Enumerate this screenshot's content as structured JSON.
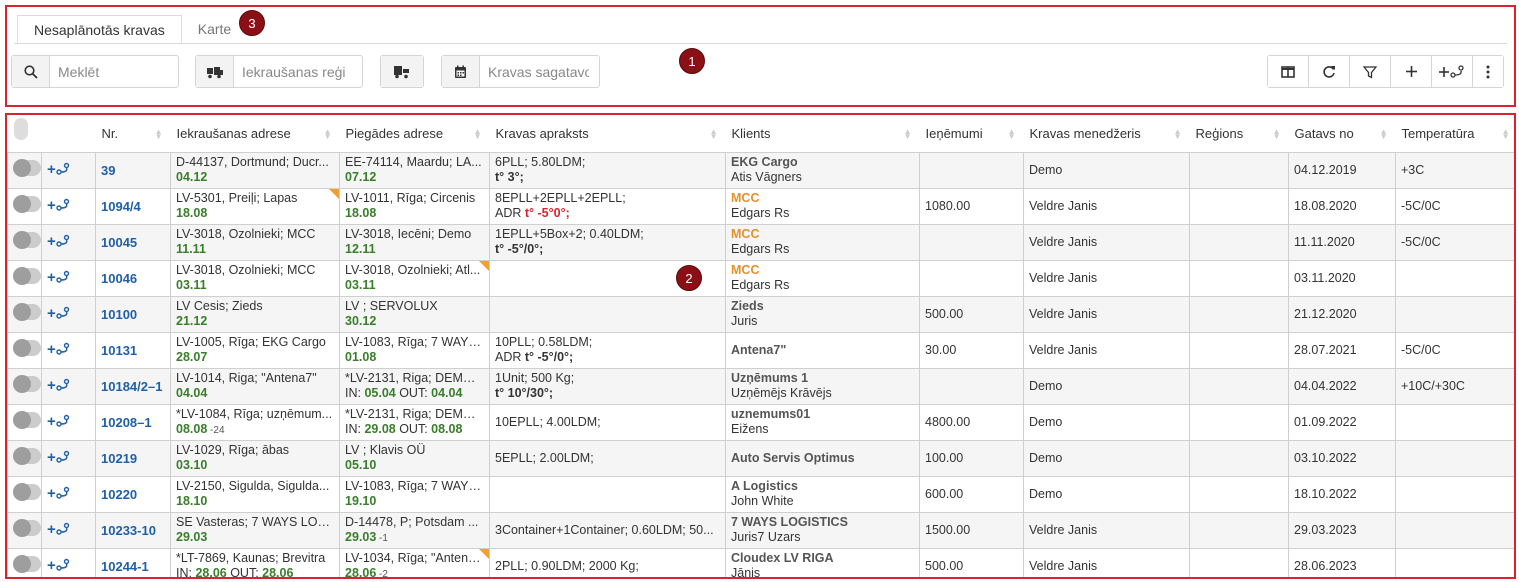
{
  "tabs": [
    {
      "label": "Nesaplānotās kravas",
      "active": true
    },
    {
      "label": "Karte",
      "active": false
    }
  ],
  "badges": [
    "1",
    "2",
    "3"
  ],
  "filters": {
    "search_placeholder": "Meklēt",
    "loading_region_placeholder": "Iekraušanas reģi",
    "cargo_ready_placeholder": "Kravas sagatavo"
  },
  "icons": {
    "search": "search-icon",
    "truck_loading": "truck-loading-icon",
    "truck_unloading": "truck-unloading-icon",
    "calendar": "calendar-icon",
    "columns": "columns-icon",
    "refresh": "refresh-icon",
    "filter": "filter-icon",
    "add": "plus-icon",
    "add_route": "add-route-icon",
    "more": "more-vertical-icon"
  },
  "colors": {
    "frame": "#d9232e",
    "badge": "#8b1015",
    "link": "#1f5fa6",
    "date": "#3a7d2c",
    "mcc": "#e0922b"
  },
  "table": {
    "headers": [
      "Nr.",
      "Iekraušanas adrese",
      "Piegādes adrese",
      "Kravas apraksts",
      "Klients",
      "Ieņēmumi",
      "Kravas menedžeris",
      "Reģions",
      "Gatavs no",
      "Temperatūra"
    ],
    "rows": [
      {
        "nr": "39",
        "load": "D-44137, Dortmund; Ducr...",
        "load_date": "04.12",
        "deliv": "EE-74114, Maardu; LA...",
        "deliv_date": "07.12",
        "desc1": "6PLL; 5.80LDM;",
        "desc2_pre": "",
        "desc2": "t° 3°;",
        "client": "EKG Cargo",
        "contact": "Atis Vāgners",
        "income": "",
        "manager": "Demo",
        "region": "",
        "ready": "04.12.2019",
        "temp": "+3C"
      },
      {
        "nr": "1094/4",
        "load": "LV-5301, Preiļi; Lapas",
        "load_date": "18.08",
        "load_flag": true,
        "deliv": "LV-1011, Rīga; Circenis",
        "deliv_date": "18.08",
        "desc1": "8EPLL+2EPLL+2EPLL;",
        "desc2_pre": "ADR ",
        "desc2": "t° -5°0°;",
        "desc2_red": true,
        "client": "MCC",
        "client_orange": true,
        "contact": "Edgars Rs",
        "income": "1080.00",
        "manager": "Veldre Janis",
        "region": "",
        "ready": "18.08.2020",
        "temp": "-5C/0C"
      },
      {
        "nr": "10045",
        "load": "LV-3018, Ozolnieki; MCC",
        "load_date": "11.11",
        "deliv": "LV-3018, Iecēni; Demo",
        "deliv_date": "12.11",
        "desc1": "1EPLL+5Box+2; 0.40LDM;",
        "desc2_pre": "",
        "desc2": "t° -5°/0°;",
        "client": "MCC",
        "client_orange": true,
        "contact": "Edgars Rs",
        "income": "",
        "manager": "Veldre Janis",
        "region": "",
        "ready": "11.11.2020",
        "temp": "-5C/0C"
      },
      {
        "nr": "10046",
        "load": "LV-3018, Ozolnieki; MCC",
        "load_date": "03.11",
        "deliv": "LV-3018, Ozolnieki; Atl...",
        "deliv_date": "03.11",
        "deliv_flag": true,
        "desc1": "",
        "desc2_pre": "",
        "desc2": "",
        "client": "MCC",
        "client_orange": true,
        "contact": "Edgars Rs",
        "income": "",
        "manager": "Veldre Janis",
        "region": "",
        "ready": "03.11.2020",
        "temp": ""
      },
      {
        "nr": "10100",
        "load": "LV Cesis; Zieds",
        "load_date": "21.12",
        "deliv": "LV ; SERVOLUX",
        "deliv_date": "30.12",
        "desc1": "",
        "desc2_pre": "",
        "desc2": "",
        "client": "Zieds",
        "contact": "Juris",
        "income": "500.00",
        "manager": "Veldre Janis",
        "region": "",
        "ready": "21.12.2020",
        "temp": ""
      },
      {
        "nr": "10131",
        "load": "LV-1005, Rīga; EKG Cargo",
        "load_date": "28.07",
        "deliv": "LV-1083, Rīga; 7 WAYS...",
        "deliv_date": "01.08",
        "desc1": "10PLL; 0.58LDM;",
        "desc2_pre": "ADR ",
        "desc2": "t° -5°/0°;",
        "client": "Antena7\"",
        "contact": "",
        "income": "30.00",
        "manager": "Veldre Janis",
        "region": "",
        "ready": "28.07.2021",
        "temp": "-5C/0C"
      },
      {
        "nr": "10184/2–1",
        "load": "LV-1014, Riga; \"Antena7\"",
        "load_date": "04.04",
        "deliv": "*LV-2131, Riga; DEMO ...",
        "deliv_in": "IN: ",
        "deliv_date": "05.04",
        "deliv_out": " OUT: ",
        "deliv_date2": "04.04",
        "desc1": "1Unit; 500 Kg;",
        "desc2_pre": "",
        "desc2": "t° 10°/30°;",
        "client": "Uzņēmums 1",
        "contact": "Uzņēmējs Krāvējs",
        "income": "",
        "manager": "Demo",
        "region": "",
        "ready": "04.04.2022",
        "temp": "+10C/+30C"
      },
      {
        "nr": "10208–1",
        "load": "*LV-1084, Rīga; uzņēmum...",
        "load_date": "08.08",
        "load_sub": " -24",
        "deliv": "*LV-2131, Riga; DEMO ...",
        "deliv_in": "IN: ",
        "deliv_date": "29.08",
        "deliv_out": " OUT: ",
        "deliv_date2": "08.08",
        "desc1": "10EPLL; 4.00LDM;",
        "desc2_pre": "",
        "desc2": "",
        "client": "uznemums01",
        "contact": "Eižens",
        "income": "4800.00",
        "manager": "Demo",
        "region": "",
        "ready": "01.09.2022",
        "temp": ""
      },
      {
        "nr": "10219",
        "load": "LV-1029, Rīga; ābas",
        "load_date": "03.10",
        "deliv": "LV ; Klavis OÜ",
        "deliv_date": "05.10",
        "desc1": "5EPLL; 2.00LDM;",
        "desc2_pre": "",
        "desc2": "",
        "client": "Auto Servis Optimus",
        "contact": "",
        "income": "100.00",
        "manager": "Demo",
        "region": "",
        "ready": "03.10.2022",
        "temp": ""
      },
      {
        "nr": "10220",
        "load": "LV-2150, Sigulda, Sigulda...",
        "load_date": "18.10",
        "deliv": "LV-1083, Rīga; 7 WAYS...",
        "deliv_date": "19.10",
        "desc1": "",
        "desc2_pre": "",
        "desc2": "",
        "client": "A Logistics",
        "contact": "John White",
        "income": "600.00",
        "manager": "Demo",
        "region": "",
        "ready": "18.10.2022",
        "temp": ""
      },
      {
        "nr": "10233-10",
        "load": "SE Vasteras; 7 WAYS LOG...",
        "load_date": "29.03",
        "deliv": "D-14478, P; Potsdam ...",
        "deliv_date": "29.03",
        "deliv_sub": " -1",
        "desc1": "3Container+1Container; 0.60LDM; 50...",
        "desc2_pre": "",
        "desc2": "",
        "client": "7 WAYS LOGISTICS",
        "contact": "Juris7 Uzars",
        "income": "1500.00",
        "manager": "Veldre Janis",
        "region": "",
        "ready": "29.03.2023",
        "temp": ""
      },
      {
        "nr": "10244-1",
        "load": "*LT-7869, Kaunas; Brevitra",
        "load_in": "IN: ",
        "load_date": "28.06",
        "load_out": " OUT: ",
        "load_date2": "28.06",
        "deliv": "LV-1034, Rīga; \"Antena...",
        "deliv_date": "28.06",
        "deliv_sub": " -2",
        "deliv_flag": true,
        "desc1": "2PLL; 0.90LDM; 2000 Kg;",
        "desc2_pre": "",
        "desc2": "",
        "client": "Cloudex LV RIGA",
        "contact": "Jānis",
        "income": "500.00",
        "manager": "Veldre Janis",
        "region": "",
        "ready": "28.06.2023",
        "temp": ""
      }
    ]
  }
}
